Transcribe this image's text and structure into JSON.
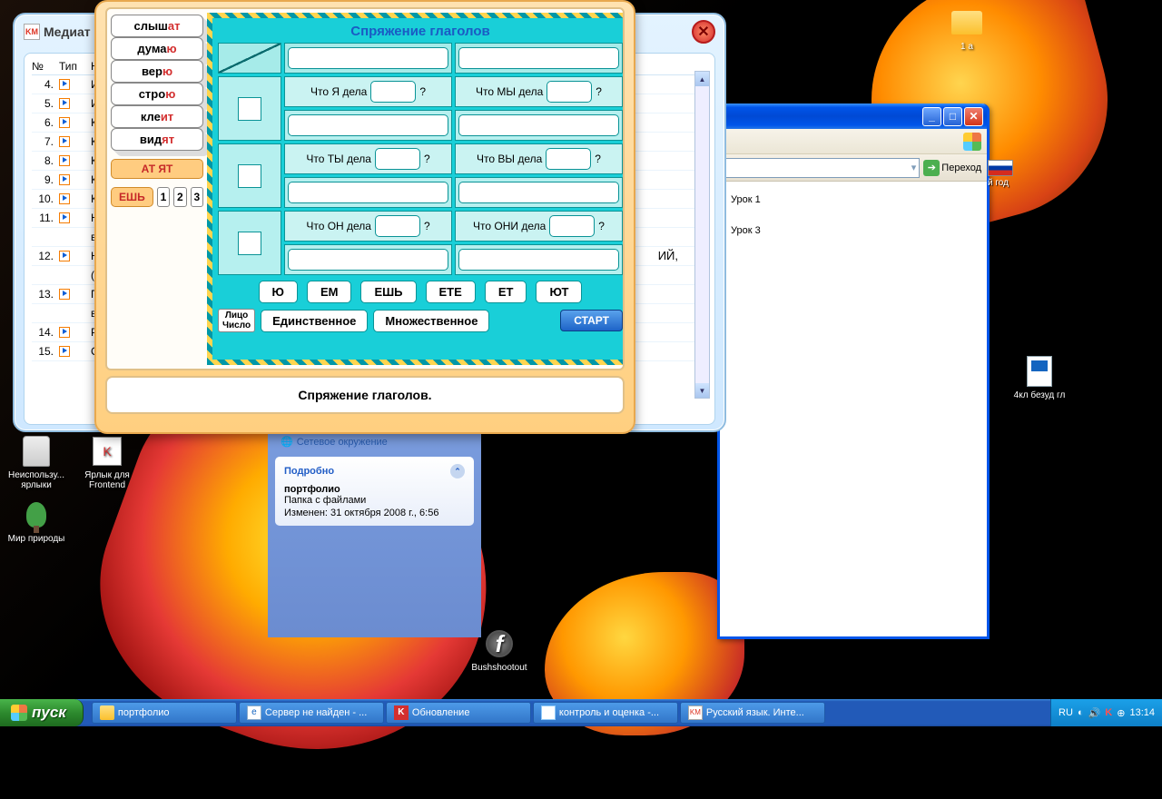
{
  "desktop": {
    "icons": {
      "folder1a": "1 а",
      "doc4kl": "4кл безуд гл",
      "unused": "Неиспользу...\nярлыки",
      "frontend": "Ярлык для\nFrontend",
      "nature": "Мир природы",
      "bush": "Bushshootout"
    }
  },
  "mediat": {
    "title": "Медиат",
    "head_no": "№",
    "head_type": "Тип",
    "head_name": "Н",
    "rows": [
      {
        "n": "4.",
        "t": "Из"
      },
      {
        "n": "5.",
        "t": "Ин"
      },
      {
        "n": "6.",
        "t": "Ка"
      },
      {
        "n": "7.",
        "t": "Ка"
      },
      {
        "n": "8.",
        "t": "Кл"
      },
      {
        "n": "9.",
        "t": "Кл"
      },
      {
        "n": "10.",
        "t": "Кл"
      },
      {
        "n": "11.",
        "t": "На"
      },
      {
        "n": "",
        "t": "вс"
      },
      {
        "n": "12.",
        "t": "На"
      },
      {
        "n": "",
        "t": "(п"
      },
      {
        "n": "13.",
        "t": "Пу"
      },
      {
        "n": "",
        "t": "вр"
      },
      {
        "n": "14.",
        "t": "Ро"
      },
      {
        "n": "15.",
        "t": "Сп"
      }
    ],
    "right_fragment": "ИЙ,"
  },
  "game": {
    "title": "Спряжение глаголов",
    "cards": [
      {
        "base": "слыш",
        "end": "ат"
      },
      {
        "base": "дума",
        "end": "ю"
      },
      {
        "base": "вер",
        "end": "ю"
      },
      {
        "base": "стро",
        "end": "ю"
      },
      {
        "base": "кле",
        "end": "ит"
      },
      {
        "base": "вид",
        "end": "ят"
      }
    ],
    "tag_atyat": "АТ ЯТ",
    "tag_esh": "ЕШЬ",
    "q_ya": "Что Я дела",
    "q_ty": "Что ТЫ дела",
    "q_on": "Что ОН дела",
    "q_my": "Что МЫ дела",
    "q_vy": "Что ВЫ дела",
    "q_oni": "Что ОНИ дела",
    "qmark": "?",
    "endings": [
      "Ю",
      "ЕМ",
      "ЕШЬ",
      "ЕТЕ",
      "ЕТ",
      "ЮТ"
    ],
    "num1": "1",
    "num2": "2",
    "num3": "3",
    "face": "Лицо",
    "number": "Число",
    "singular": "Единственное",
    "plural": "Множественное",
    "start": "СТАРТ",
    "caption": "Спряжение глаголов."
  },
  "explorer_panel": {
    "network": "Сетевое окружение",
    "details_h": "Подробно",
    "name": "портфолио",
    "type": "Папка с файлами",
    "modified": "Изменен: 31 октября 2008 г., 6:56"
  },
  "lessons_win": {
    "go": "Переход",
    "items": [
      "Урок 1",
      "Урок 3"
    ],
    "year_frag": "й год"
  },
  "taskbar": {
    "start": "пуск",
    "items": [
      "портфолио",
      "Сервер не найден - ...",
      "Обновление",
      "контроль и оценка -...",
      "Русский язык. Инте..."
    ],
    "lang": "RU",
    "time": "13:14"
  }
}
